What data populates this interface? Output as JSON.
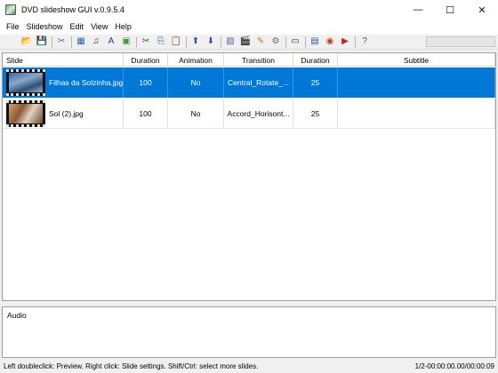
{
  "window": {
    "title": "DVD slideshow GUI v.0.9.5.4"
  },
  "menu": [
    "File",
    "Slideshow",
    "Edit",
    "View",
    "Help"
  ],
  "toolbar": {
    "groups": [
      [
        {
          "name": "new-file-icon",
          "glyph": "🗋",
          "color": "#ffffff"
        },
        {
          "name": "open-folder-icon",
          "glyph": "📂",
          "color": "#e0b030"
        },
        {
          "name": "save-icon",
          "glyph": "💾",
          "color": "#2a4fa0"
        }
      ],
      [
        {
          "name": "tools-icon",
          "glyph": "✂",
          "color": "#3d6db0"
        }
      ],
      [
        {
          "name": "add-image-icon",
          "glyph": "▦",
          "color": "#2a6aa8"
        },
        {
          "name": "add-music-icon",
          "glyph": "♫",
          "color": "#333"
        },
        {
          "name": "add-text-icon",
          "glyph": "A",
          "color": "#2a3a8a"
        },
        {
          "name": "add-background-icon",
          "glyph": "▣",
          "color": "#3a9a3a"
        }
      ],
      [
        {
          "name": "cut-icon",
          "glyph": "✂",
          "color": "#444"
        },
        {
          "name": "copy-icon",
          "glyph": "⎘",
          "color": "#2a5a9a"
        },
        {
          "name": "paste-icon",
          "glyph": "📋",
          "color": "#b08030"
        }
      ],
      [
        {
          "name": "move-up-icon",
          "glyph": "⬆",
          "color": "#2a4fb0"
        },
        {
          "name": "move-down-icon",
          "glyph": "⬇",
          "color": "#2a4fb0"
        }
      ],
      [
        {
          "name": "image-edit-icon",
          "glyph": "▨",
          "color": "#7a5a9a"
        },
        {
          "name": "clapper-icon",
          "glyph": "🎬",
          "color": "#222"
        },
        {
          "name": "brush-icon",
          "glyph": "✎",
          "color": "#c08020"
        },
        {
          "name": "settings-icon",
          "glyph": "⚙",
          "color": "#666"
        }
      ],
      [
        {
          "name": "slideshow-preview-icon",
          "glyph": "▭",
          "color": "#333"
        }
      ],
      [
        {
          "name": "save-dvd-icon",
          "glyph": "▤",
          "color": "#2a5a9a"
        },
        {
          "name": "burn-disc-icon",
          "glyph": "◉",
          "color": "#c04020"
        },
        {
          "name": "youtube-icon",
          "glyph": "▶",
          "color": "#cc2020"
        }
      ],
      [
        {
          "name": "help-icon",
          "glyph": "?",
          "color": "#1e5fbf"
        }
      ]
    ]
  },
  "slides_table": {
    "columns": [
      "Slide",
      "Duration",
      "Animation",
      "Transition",
      "Duration",
      "Subtitle"
    ],
    "rows": [
      {
        "file": "Filhas da Solzinha.jpg",
        "duration": "100",
        "animation": "No",
        "transition": "Central_Rotate_...",
        "transition_duration": "25",
        "subtitle": "",
        "selected": true
      },
      {
        "file": "Sol (2).jpg",
        "duration": "100",
        "animation": "No",
        "transition": "Accord_Horisont...",
        "transition_duration": "25",
        "subtitle": "",
        "selected": false
      }
    ]
  },
  "audio": {
    "label": "Audio"
  },
  "status": {
    "hint": "Left doubleclick: Preview. Right click: Slide settings. Shift/Ctrl: select more slides.",
    "position": "1/2-00:00:00.00/00:00:09"
  },
  "colors": {
    "selection": "#0078d7"
  }
}
